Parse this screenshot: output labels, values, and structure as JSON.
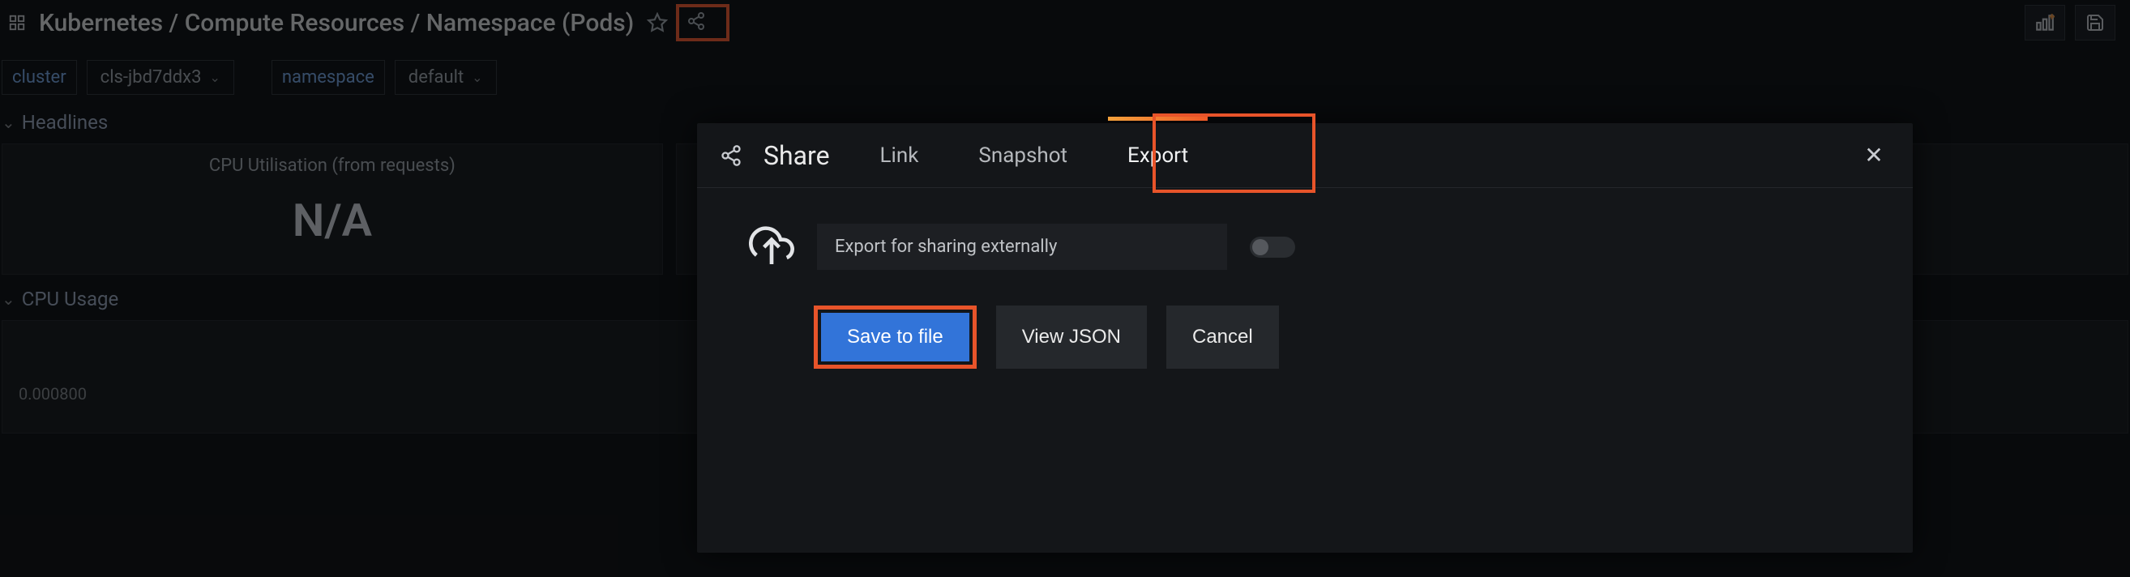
{
  "header": {
    "title": "Kubernetes / Compute Resources / Namespace (Pods)"
  },
  "filters": {
    "cluster_label": "cluster",
    "cluster_value": "cls-jbd7ddx3",
    "namespace_label": "namespace",
    "namespace_value": "default"
  },
  "sections": {
    "headlines": "Headlines",
    "cpu_usage": "CPU Usage"
  },
  "panels": [
    {
      "title": "CPU Utilisation (from requests)",
      "value": "N/A"
    }
  ],
  "cpu_chart": {
    "yticks": [
      "0.000800"
    ]
  },
  "share_modal": {
    "title": "Share",
    "tabs": {
      "link": "Link",
      "snapshot": "Snapshot",
      "export": "Export"
    },
    "active_tab": "export",
    "export_label": "Export for sharing externally",
    "buttons": {
      "save": "Save to file",
      "view": "View JSON",
      "cancel": "Cancel"
    }
  }
}
